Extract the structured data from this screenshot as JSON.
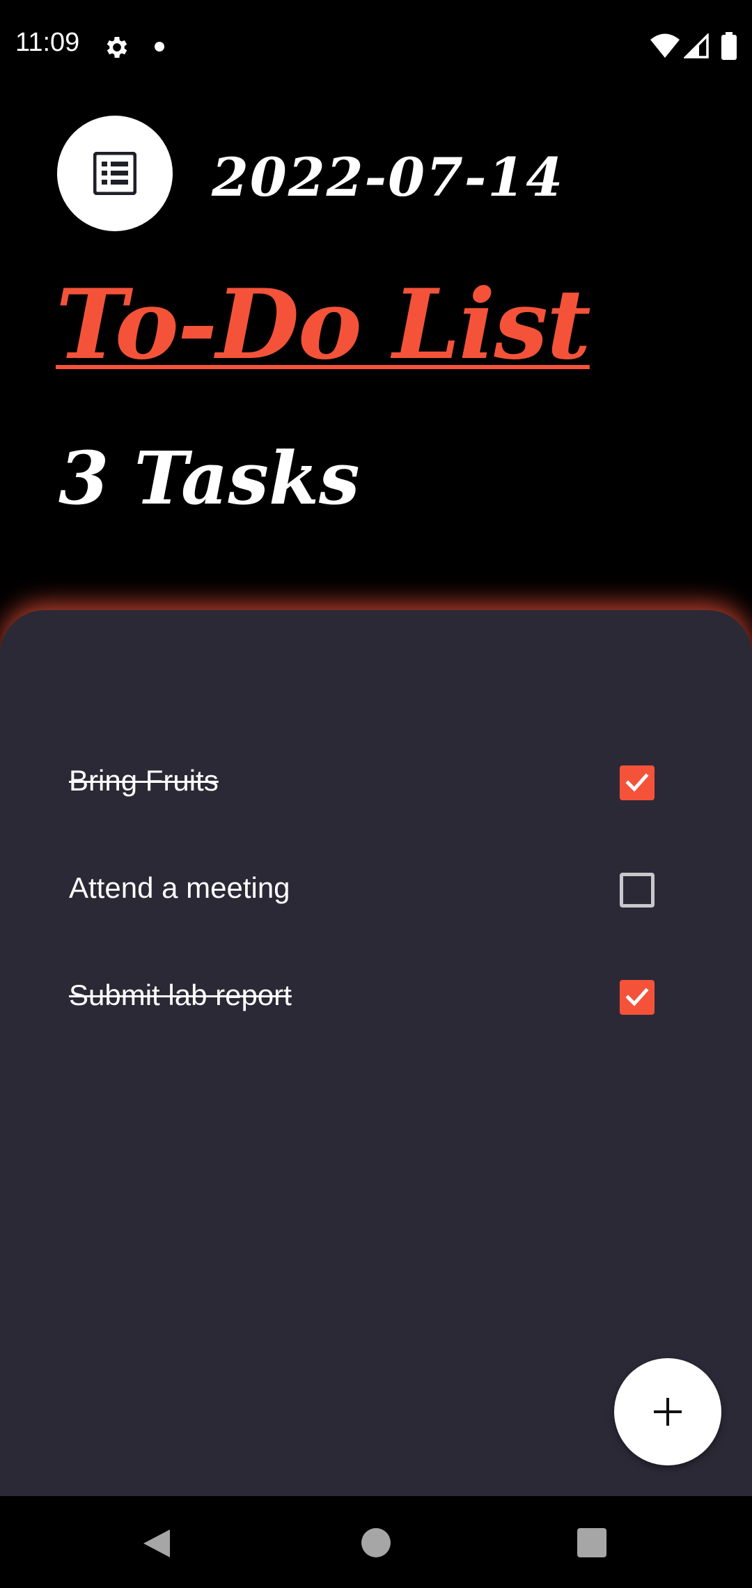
{
  "status_bar": {
    "time": "11:09",
    "icons": [
      "gear-icon",
      "notification-dot-icon",
      "wifi-icon",
      "signal-icon",
      "battery-icon"
    ]
  },
  "header": {
    "icon": "list-icon",
    "date": "2022-07-14",
    "title": "To-Do List",
    "task_count": "3 Tasks"
  },
  "tasks": [
    {
      "label": "Bring Fruits",
      "done": true
    },
    {
      "label": "Attend a meeting",
      "done": false
    },
    {
      "label": "Submit lab report",
      "done": true
    }
  ],
  "fab": {
    "icon": "plus-icon"
  },
  "nav_bar": {
    "icons": [
      "back-icon",
      "home-icon",
      "recents-icon"
    ]
  },
  "colors": {
    "accent": "#f4533a",
    "background": "#000000",
    "panel": "#2b2936",
    "text": "#ffffff"
  }
}
